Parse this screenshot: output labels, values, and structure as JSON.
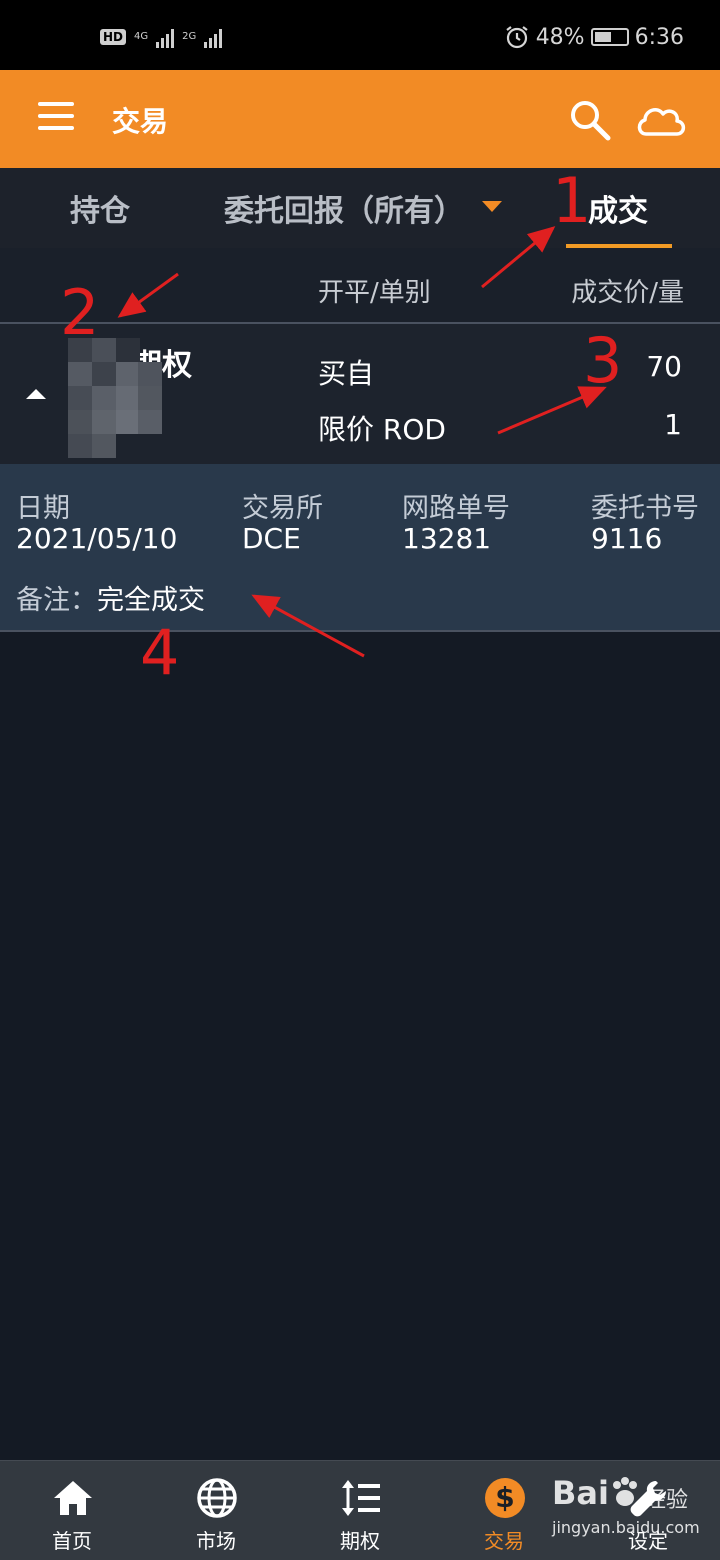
{
  "status_bar": {
    "hd": "HD",
    "sim1_net": "4G",
    "sim2_net": "2G",
    "battery": "48%",
    "time": "6:36"
  },
  "app_bar": {
    "title": "交易",
    "icons": [
      "menu-icon",
      "search-icon",
      "cloud-icon"
    ],
    "color": "#f28b25"
  },
  "tabs": {
    "items": [
      {
        "label": "持仓",
        "active": false
      },
      {
        "label": "委托回报（所有）",
        "active": false,
        "has_dropdown": true
      },
      {
        "label": "成交",
        "active": true
      }
    ]
  },
  "columns": {
    "col1": "开平/单别",
    "col2": "成交价/量"
  },
  "trade": {
    "instrument": "期权",
    "side": "买自",
    "order_type": "限价  ROD",
    "price": "70",
    "quantity": "1"
  },
  "detail": {
    "date_label": "日期",
    "date": "2021/05/10",
    "exchange_label": "交易所",
    "exchange": "DCE",
    "net_order_label": "网路单号",
    "net_order": "13281",
    "entrust_label": "委托书号",
    "entrust": "9116",
    "remark_label": "备注：",
    "remark": "完全成交"
  },
  "annotations": [
    "1",
    "2",
    "3",
    "4"
  ],
  "bottom_nav": {
    "items": [
      {
        "label": "首页",
        "icon": "home-icon",
        "active": false
      },
      {
        "label": "市场",
        "icon": "globe-icon",
        "active": false
      },
      {
        "label": "期权",
        "icon": "sort-list-icon",
        "active": false
      },
      {
        "label": "交易",
        "icon": "dollar-icon",
        "active": true
      },
      {
        "label": "设定",
        "icon": "wrench-icon",
        "active": false
      }
    ]
  },
  "watermark": {
    "brand": "Bai",
    "brand_cn": "经验",
    "url": "jingyan.baidu.com"
  }
}
